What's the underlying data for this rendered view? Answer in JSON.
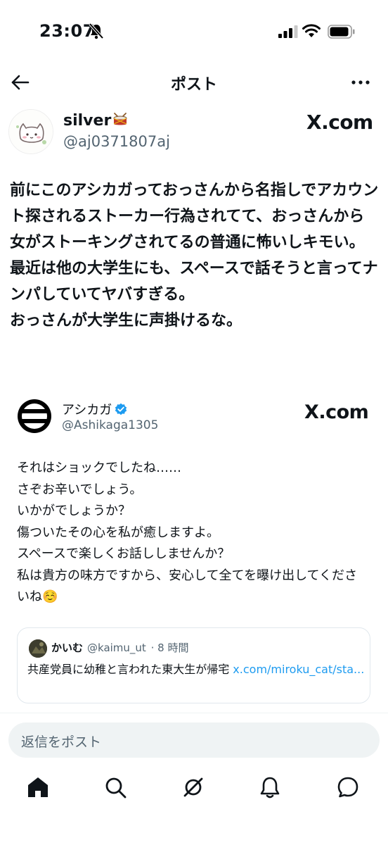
{
  "status_bar": {
    "time": "23:07"
  },
  "header": {
    "title": "ポスト"
  },
  "post": {
    "author_name": "silver",
    "author_handle": "@aj0371807aj",
    "watermark": "X.com",
    "text": "前にこのアシカガっておっさんから名指しでアカウント探されるストーカー行為されてて、おっさんから女がストーキングされてるの普通に怖いしキモい。\n最近は他の大学生にも、スペースで話そうと言ってナンパしていてヤバすぎる。\nおっさんが大学生に声掛けるな。"
  },
  "quoted": {
    "name": "アシカガ",
    "handle": "@Ashikaga1305",
    "watermark": "X.com",
    "text": "それはショックでしたね……\nさぞお辛いでしょう。\nいかがでしょうか？\n傷ついたその心を私が癒しますよ。\nスペースで楽しくお話ししませんか？\n私は貴方の味方ですから、安心して全てを曝け出してくださいね☺️"
  },
  "nested_quote": {
    "name": "かいむ",
    "handle": "@kaimu_ut",
    "time": "· 8 時間",
    "text": "共産党員に幼稚と言われた東大生が帰宅 ",
    "link": "x.com/miroku_cat/sta..."
  },
  "reply": {
    "placeholder": "返信をポスト"
  },
  "icons": {
    "back": "back-arrow-icon",
    "more": "more-horizontal-icon",
    "home": "home-icon",
    "search": "search-icon",
    "grok": "grok-icon",
    "notifications": "bell-icon",
    "messages": "message-icon"
  },
  "colors": {
    "link": "#1d9bf0",
    "secondary_text": "#536471",
    "verified": "#1d9bf0"
  }
}
